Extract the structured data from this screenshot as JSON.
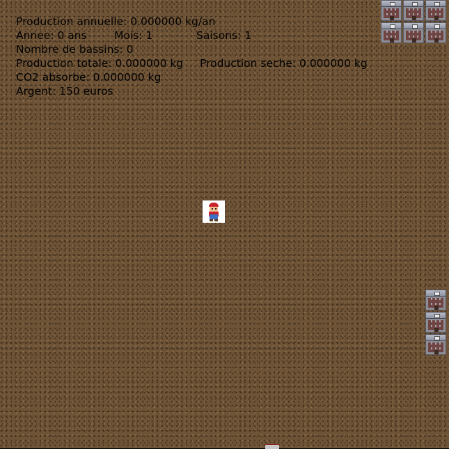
{
  "hud": {
    "production_annuelle": "Production annuelle: 0.000000 kg/an",
    "annee": "Annee: 0 ans",
    "mois": "Mois: 1",
    "saisons": "Saisons: 1",
    "nombre_bassins": "Nombre de bassins: 0",
    "production_totale": "Production totale: 0.000000 kg",
    "production_seche": "Production seche: 0.000000 kg",
    "co2": "CO2 absorbe: 0.000000 kg",
    "argent": "Argent: 150 euros"
  },
  "sprites": {
    "player": "player-character",
    "building": "building-icon"
  },
  "colors": {
    "ground": "#6e5336",
    "text": "#000000",
    "background": "#000000"
  }
}
